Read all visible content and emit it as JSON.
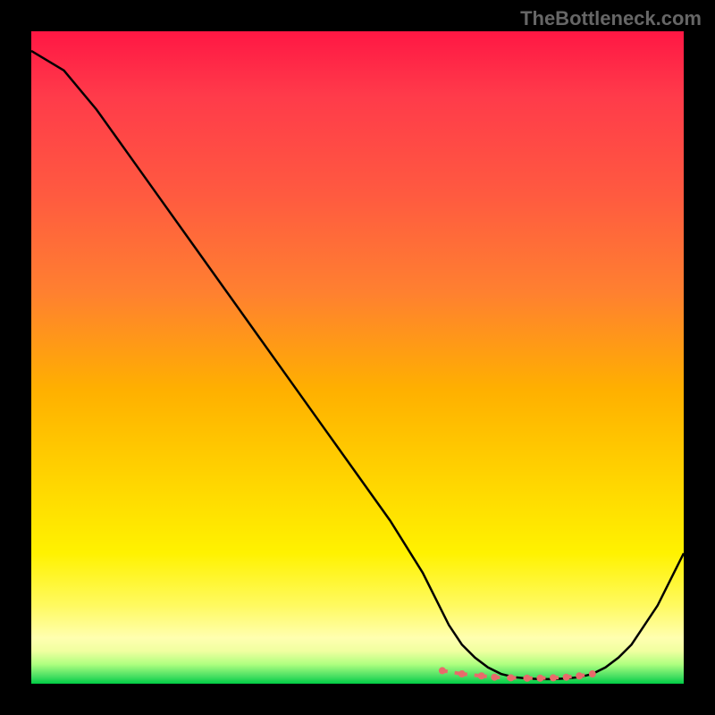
{
  "watermark": "TheBottleneck.com",
  "chart_data": {
    "type": "line",
    "title": "",
    "xlabel": "",
    "ylabel": "",
    "xlim": [
      0,
      100
    ],
    "ylim": [
      0,
      100
    ],
    "series": [
      {
        "name": "bottleneck-curve",
        "x": [
          0,
          5,
          10,
          15,
          20,
          25,
          30,
          35,
          40,
          45,
          50,
          55,
          60,
          62,
          64,
          66,
          68,
          70,
          72,
          74,
          76,
          78,
          80,
          82,
          84,
          86,
          88,
          90,
          92,
          94,
          96,
          98,
          100
        ],
        "y": [
          97,
          94,
          88,
          81,
          74,
          67,
          60,
          53,
          46,
          39,
          32,
          25,
          17,
          13,
          9,
          6,
          4,
          2.5,
          1.5,
          1,
          0.8,
          0.7,
          0.7,
          0.8,
          1,
          1.5,
          2.5,
          4,
          6,
          9,
          12,
          16,
          20
        ]
      },
      {
        "name": "optimal-range-markers",
        "x": [
          63,
          66,
          69,
          71,
          73.5,
          76,
          78,
          80,
          82,
          84,
          86
        ],
        "y": [
          2,
          1.5,
          1.2,
          1,
          0.9,
          0.85,
          0.85,
          0.9,
          1,
          1.2,
          1.5
        ]
      }
    ],
    "gradient_stops": [
      {
        "pos": 0,
        "color": "#ff1744"
      },
      {
        "pos": 25,
        "color": "#ff5a40"
      },
      {
        "pos": 55,
        "color": "#ffb000"
      },
      {
        "pos": 80,
        "color": "#fff200"
      },
      {
        "pos": 95,
        "color": "#f0ffa0"
      },
      {
        "pos": 100,
        "color": "#00cc44"
      }
    ]
  }
}
